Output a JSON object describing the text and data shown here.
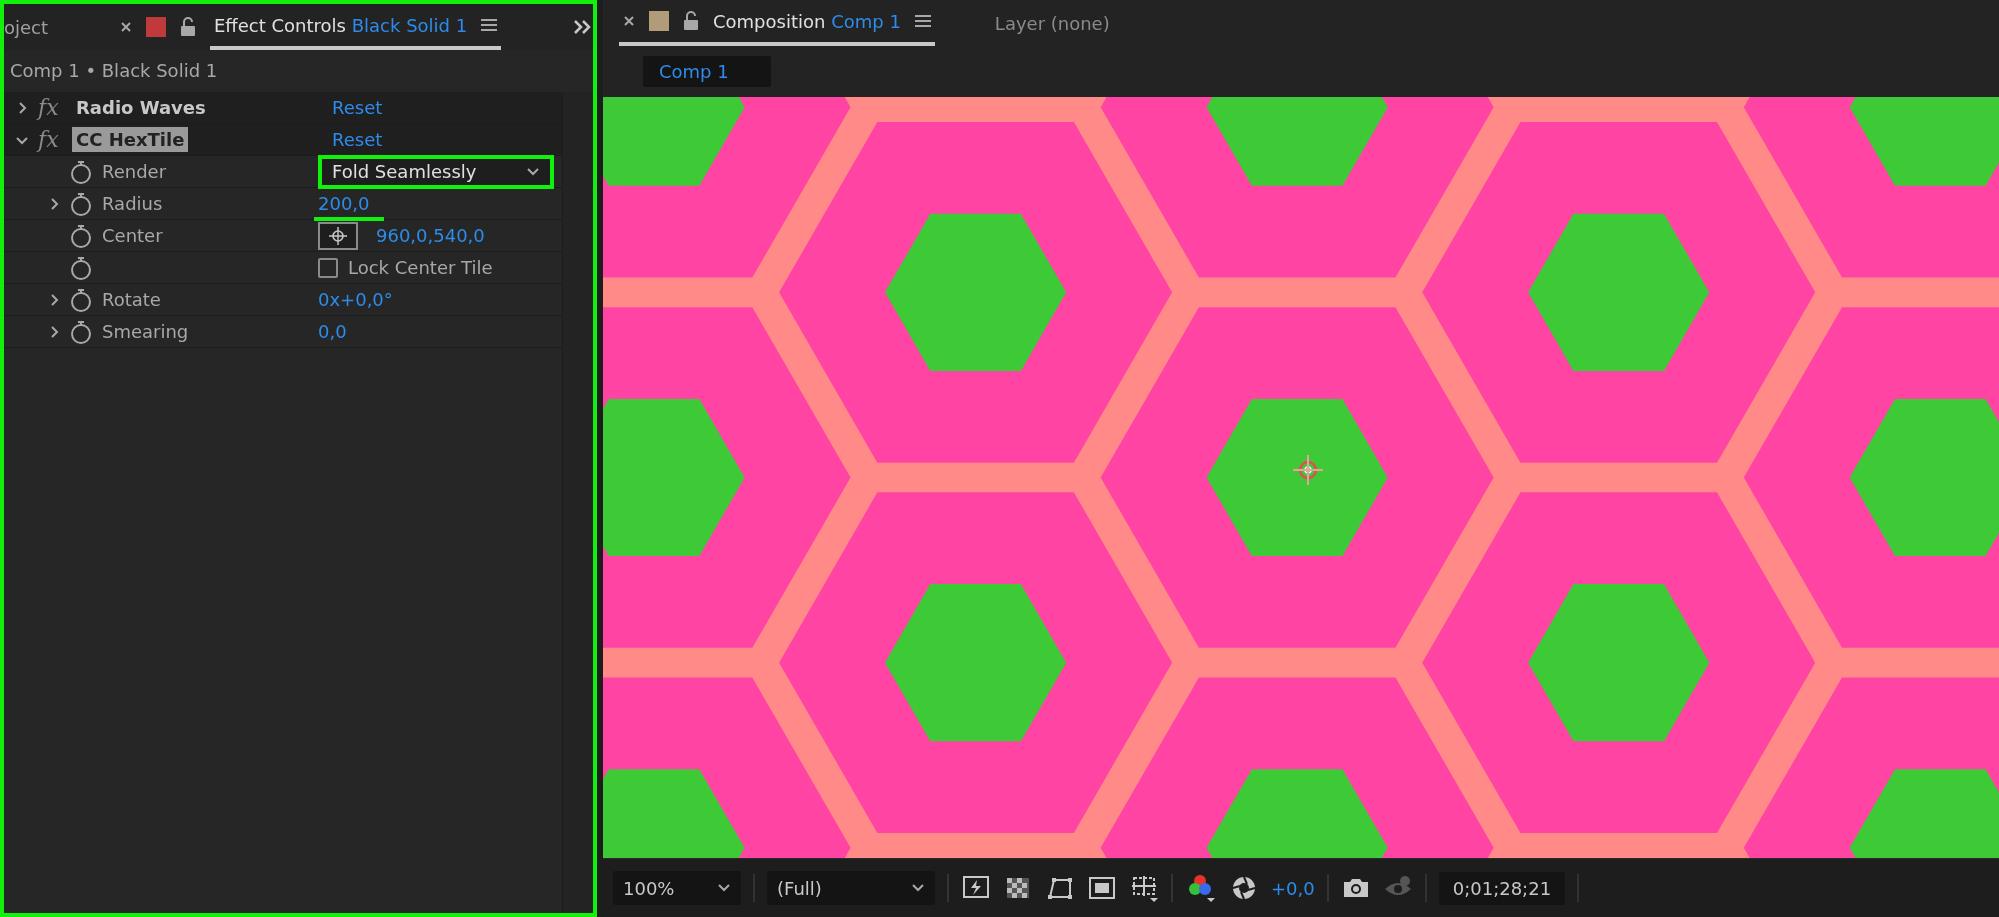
{
  "effect_controls_panel": {
    "highlighted": true,
    "cut_tab": "oject",
    "tab": {
      "title": "Effect Controls",
      "layer": "Black Solid 1",
      "selected": true
    },
    "breadcrumb": "Comp 1 • Black Solid 1",
    "effects": [
      {
        "fx": "fx",
        "name": "Radio Waves",
        "reset": "Reset",
        "expanded": false,
        "selected": false
      },
      {
        "fx": "fx",
        "name": "CC HexTile",
        "reset": "Reset",
        "expanded": true,
        "selected": true,
        "properties": [
          {
            "kind": "dropdown",
            "label": "Render",
            "value": "Fold Seamlessly",
            "expandable": false,
            "highlighted": true
          },
          {
            "kind": "number",
            "label": "Radius",
            "value": "200,0",
            "expandable": true,
            "highlighted": true
          },
          {
            "kind": "point",
            "label": "Center",
            "value": "960,0,540,0",
            "expandable": false
          },
          {
            "kind": "checkbox",
            "label": "Lock Center Tile",
            "checked": false,
            "expandable": false
          },
          {
            "kind": "number",
            "label": "Rotate",
            "value": "0x+0,0°",
            "expandable": true
          },
          {
            "kind": "number",
            "label": "Smearing",
            "value": "0,0",
            "expandable": true
          }
        ]
      }
    ]
  },
  "composition_panel": {
    "tab": {
      "title": "Composition",
      "comp": "Comp 1",
      "selected": true
    },
    "layer_tab": "Layer (none)",
    "comp_chip": "Comp 1",
    "toolbar": {
      "zoom": "100%",
      "resolution": "(Full)",
      "exposure": "+0,0",
      "timecode": "0;01;28;21"
    }
  }
}
